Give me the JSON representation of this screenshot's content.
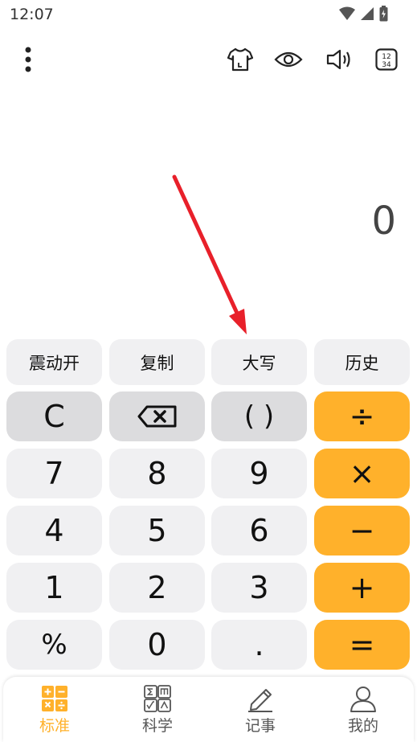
{
  "status_bar": {
    "time": "12:07"
  },
  "toolbar": {
    "menu_icon": "more-vertical-icon",
    "theme_icon": "tshirt-icon",
    "eye_icon": "eye-icon",
    "sound_icon": "speaker-icon",
    "numbers_icon": "digits-icon"
  },
  "display": {
    "value": "0"
  },
  "function_buttons": [
    {
      "label": "震动开"
    },
    {
      "label": "复制"
    },
    {
      "label": "大写"
    },
    {
      "label": "历史"
    }
  ],
  "keys": {
    "clear": "C",
    "parens": "( )",
    "divide": "÷",
    "seven": "7",
    "eight": "8",
    "nine": "9",
    "multiply": "×",
    "four": "4",
    "five": "5",
    "six": "6",
    "minus": "−",
    "one": "1",
    "two": "2",
    "three": "3",
    "plus": "+",
    "percent": "%",
    "zero": "0",
    "dot": ".",
    "equals": "="
  },
  "bottom_nav": [
    {
      "label": "标准",
      "active": true
    },
    {
      "label": "科学",
      "active": false
    },
    {
      "label": "记事",
      "active": false
    },
    {
      "label": "我的",
      "active": false
    }
  ],
  "colors": {
    "accent": "#ffb12b",
    "key_bg": "#f0f0f2",
    "key_gray": "#dcdcde",
    "annotation_arrow": "#e8202a"
  }
}
